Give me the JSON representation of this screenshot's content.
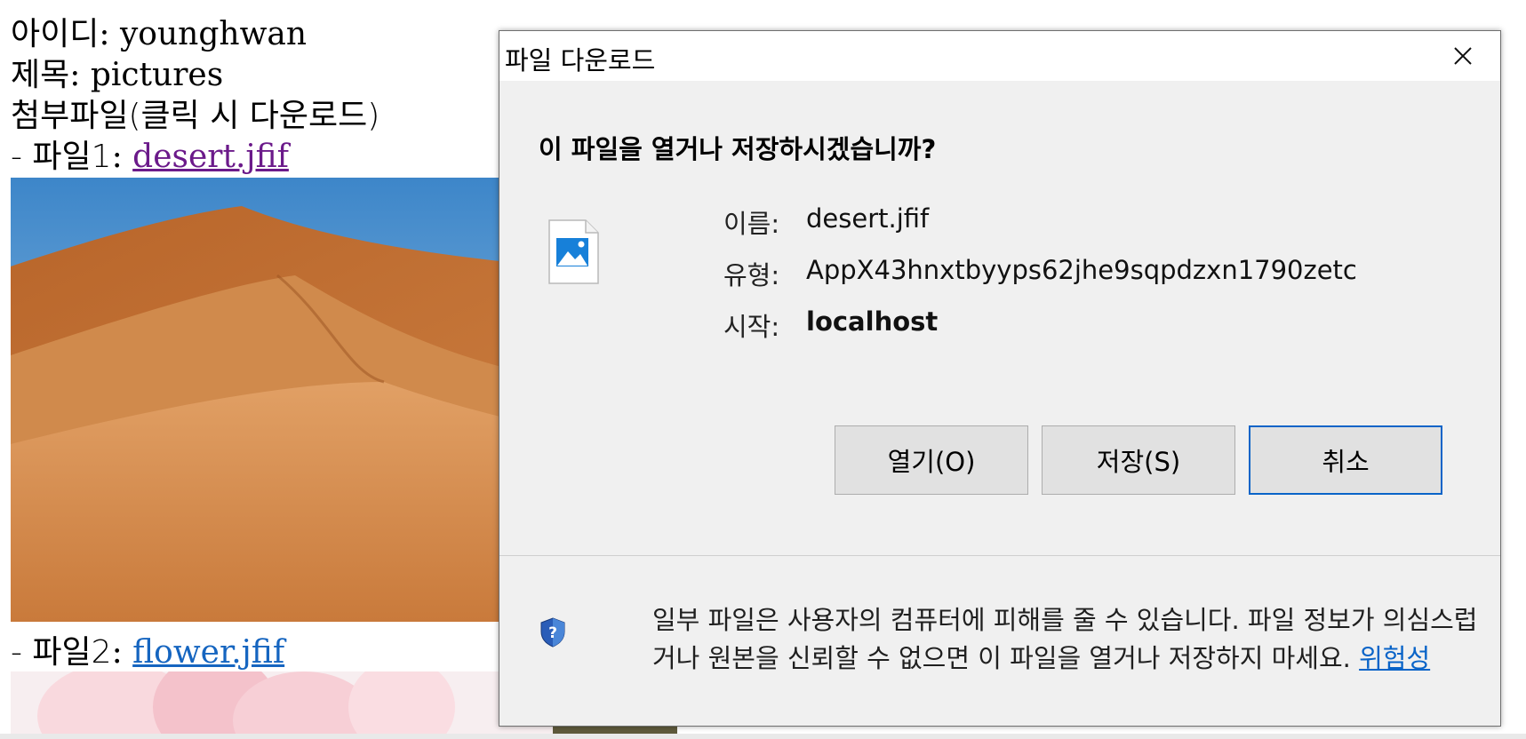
{
  "post": {
    "id_label": "아이디",
    "id_value": "younghwan",
    "title_label": "제목",
    "title_value": "pictures",
    "attachments_heading": "첨부파일(클릭 시 다운로드)",
    "files": [
      {
        "prefix": "- 파일1",
        "name": "desert.jfif"
      },
      {
        "prefix": "- 파일2",
        "name": "flower.jfif"
      }
    ]
  },
  "dialog": {
    "title": "파일 다운로드",
    "question": "이 파일을 열거나 저장하시겠습니까?",
    "name_label": "이름:",
    "name_value": "desert.jfif",
    "type_label": "유형:",
    "type_value": "AppX43hnxtbyyps62jhe9sqpdzxn1790zetc",
    "from_label": "시작:",
    "from_value": "localhost",
    "buttons": {
      "open": "열기(O)",
      "save": "저장(S)",
      "cancel": "취소"
    },
    "warning_text": "일부 파일은 사용자의 컴퓨터에 피해를 줄 수 있습니다. 파일 정보가 의심스럽거나 원본을 신뢰할 수 없으면 이 파일을 열거나 저장하지 마세요.",
    "risk_link": "위험성"
  },
  "icons": {
    "close": "close-icon",
    "file": "image-file-icon",
    "shield": "shield-question-icon"
  },
  "colors": {
    "visited_link": "#6b1a8a",
    "link": "#1565c0",
    "dialog_bg": "#f0f0f0",
    "button_focus": "#0a64c8"
  }
}
